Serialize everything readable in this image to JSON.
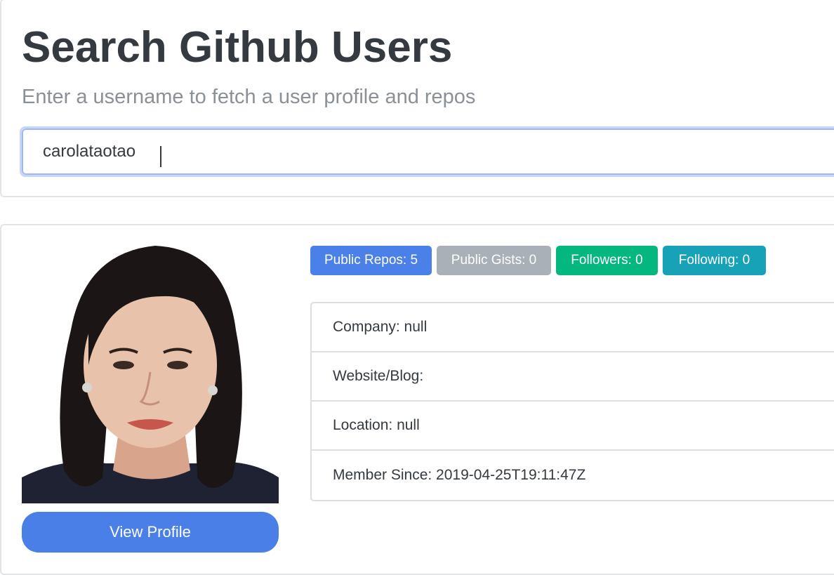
{
  "header": {
    "title": "Search Github Users",
    "subtitle": "Enter a username to fetch a user profile and repos"
  },
  "search": {
    "value": "carolataotao"
  },
  "profile": {
    "view_profile_label": "View Profile",
    "badges": {
      "public_repos": "Public Repos: 5",
      "public_gists": "Public Gists: 0",
      "followers": "Followers: 0",
      "following": "Following: 0"
    },
    "details": {
      "company": "Company: null",
      "website": "Website/Blog:",
      "location": "Location: null",
      "member_since": "Member Since: 2019-04-25T19:11:47Z"
    }
  },
  "colors": {
    "primary": "#4a80e8",
    "secondary": "#a9b0b7",
    "success": "#03b77e",
    "info": "#17a2b8",
    "text": "#343a40"
  }
}
